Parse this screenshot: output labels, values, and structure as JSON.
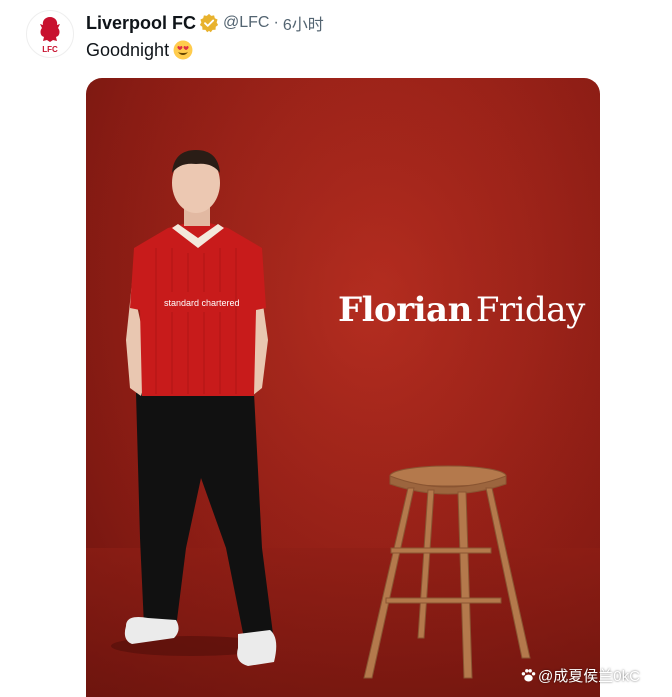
{
  "post": {
    "author_name": "Liverpool FC",
    "verified_icon": "verified-badge-icon",
    "handle": "@LFC",
    "separator": "·",
    "time": "6小时",
    "text": "Goodnight",
    "emoji": "heart-eyes-emoji",
    "avatar_logo": "LFC"
  },
  "media": {
    "overlay_first": "Florian",
    "overlay_second": "Friday",
    "background_color": "#a0241a",
    "shirt_sponsor": "standard chartered"
  },
  "watermark": {
    "text": "@成夏侯兰0kC",
    "icon": "paw-icon"
  },
  "colors": {
    "text_primary": "#0f1419",
    "text_secondary": "#536471",
    "verified_gold": "#e8b22e",
    "lfc_red": "#c8102e"
  }
}
